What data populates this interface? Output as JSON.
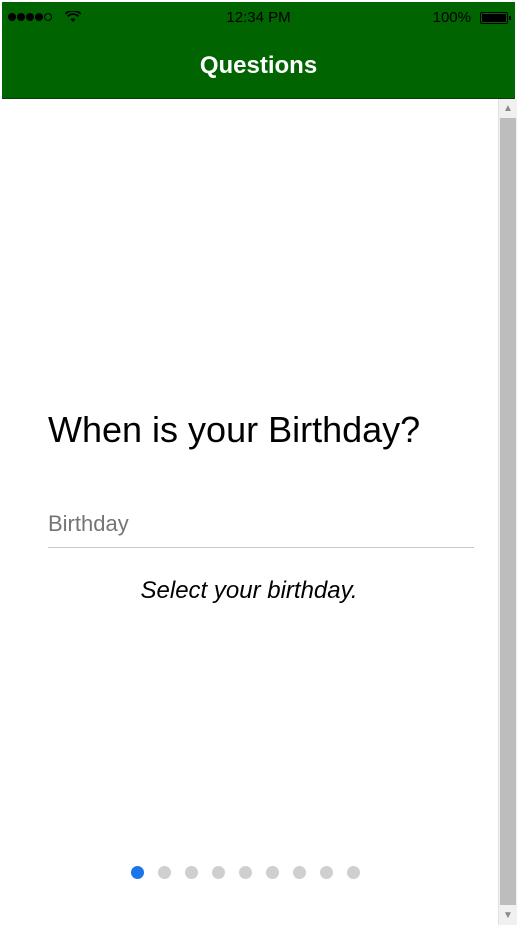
{
  "status_bar": {
    "time": "12:34 PM",
    "battery_percent": "100%",
    "signal_icon": "signal-dots-icon",
    "wifi_icon": "wifi-icon",
    "battery_icon": "battery-icon"
  },
  "nav": {
    "title": "Questions",
    "background": "#006400"
  },
  "question": {
    "title": "When is your Birthday?",
    "field_placeholder": "Birthday",
    "helper_text": "Select your birthday."
  },
  "pager": {
    "total": 9,
    "active_index": 0,
    "active_color": "#1a75e8",
    "inactive_color": "#cfcfcf"
  },
  "scrollbar": {
    "up_icon": "chevron-up-icon",
    "down_icon": "chevron-down-icon"
  }
}
